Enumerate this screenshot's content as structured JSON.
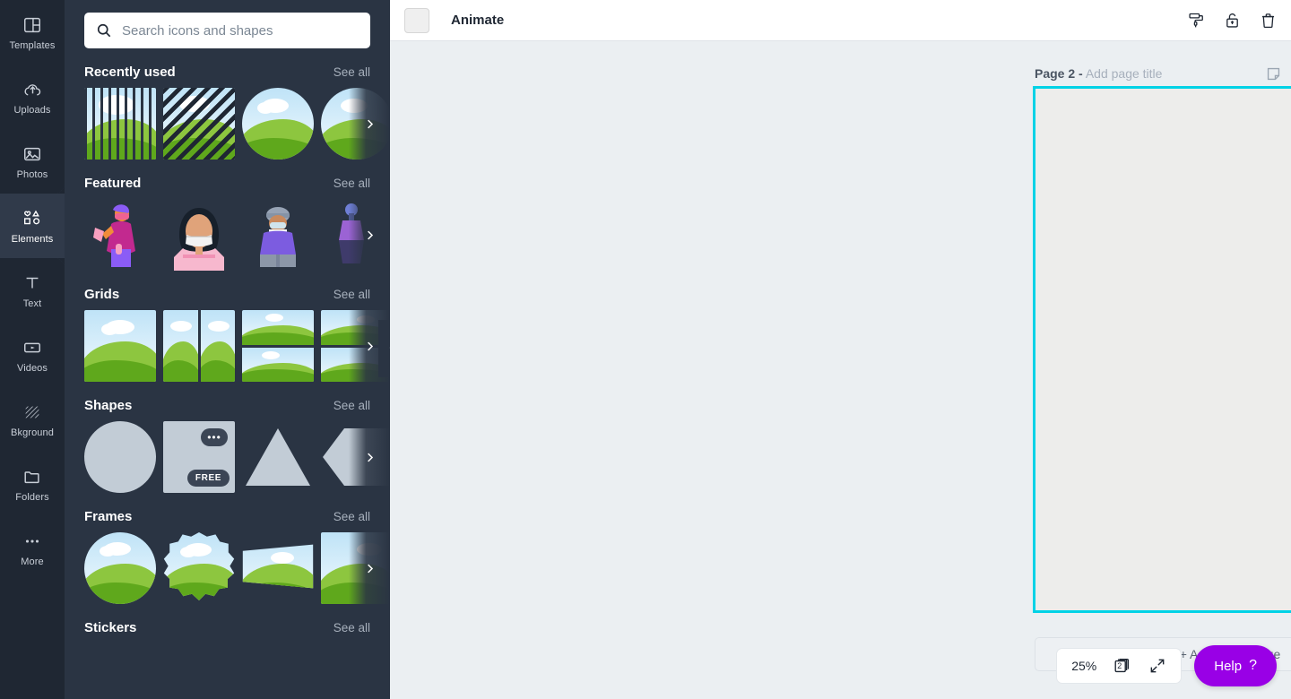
{
  "rail": {
    "items": [
      {
        "label": "Templates",
        "icon": "templates-icon",
        "active": false
      },
      {
        "label": "Uploads",
        "icon": "upload-cloud-icon",
        "active": false
      },
      {
        "label": "Photos",
        "icon": "photo-icon",
        "active": false
      },
      {
        "label": "Elements",
        "icon": "elements-icon",
        "active": true
      },
      {
        "label": "Text",
        "icon": "text-icon",
        "active": false
      },
      {
        "label": "Videos",
        "icon": "video-icon",
        "active": false
      },
      {
        "label": "Bkground",
        "icon": "background-hatch-icon",
        "active": false
      },
      {
        "label": "Folders",
        "icon": "folder-icon",
        "active": false
      },
      {
        "label": "More",
        "icon": "ellipsis-icon",
        "active": false
      }
    ]
  },
  "panel": {
    "search": {
      "placeholder": "Search icons and shapes",
      "value": "",
      "icon": "search-icon"
    },
    "see_all_label": "See all",
    "sections": [
      {
        "title": "Recently used"
      },
      {
        "title": "Featured"
      },
      {
        "title": "Grids"
      },
      {
        "title": "Shapes"
      },
      {
        "title": "Frames"
      },
      {
        "title": "Stickers"
      }
    ],
    "badges": {
      "more": "•••",
      "free": "FREE"
    },
    "collapse_icon": "chevron-left-icon",
    "next_icon": "chevron-right-icon"
  },
  "topbar": {
    "color_swatch": {
      "name": "color-swatch",
      "color": "#EFEFEF"
    },
    "animate_label": "Animate",
    "icons": [
      {
        "name": "paint-roller-icon"
      },
      {
        "name": "unlock-icon"
      },
      {
        "name": "trash-icon"
      }
    ]
  },
  "page": {
    "label_prefix": "Page 2 -",
    "title_placeholder": "Add page title",
    "tools": [
      {
        "name": "notes-icon"
      },
      {
        "name": "move-up-icon"
      },
      {
        "name": "move-down-icon"
      },
      {
        "name": "duplicate-icon"
      },
      {
        "name": "delete-page-icon"
      },
      {
        "name": "add-page-icon"
      }
    ],
    "comment_icon": "add-comment-icon",
    "add_page_label": "+ Add a new page"
  },
  "footer": {
    "zoom_level": "25%",
    "page_count": "2",
    "expand_icon": "expand-icon",
    "help_label": "Help",
    "help_question": "?",
    "help_color": "#9900E6"
  },
  "colors": {
    "rail_bg": "#1F2733",
    "panel_bg": "#2A3443",
    "selection": "#00D2E6",
    "canvas": "#EDEDEB",
    "workspace": "#EBEFF2"
  }
}
